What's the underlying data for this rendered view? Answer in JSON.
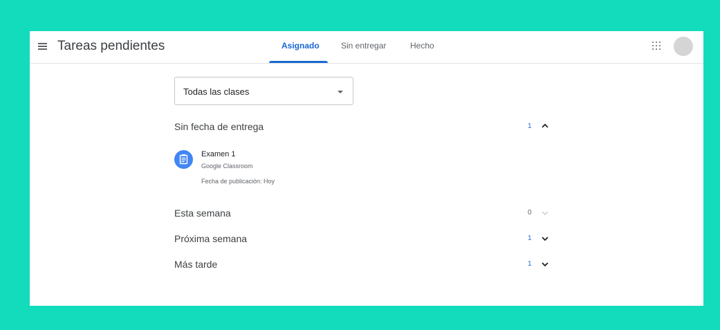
{
  "header": {
    "title": "Tareas pendientes",
    "tabs": [
      {
        "label": "Asignado",
        "active": true
      },
      {
        "label": "Sin entregar",
        "active": false
      },
      {
        "label": "Hecho",
        "active": false
      }
    ],
    "icons": [
      "menu-icon",
      "apps-grid-icon",
      "avatar"
    ]
  },
  "filter": {
    "selected": "Todas las clases"
  },
  "sections": [
    {
      "title": "Sin fecha de entrega",
      "count": "1",
      "expanded": true,
      "items": [
        {
          "title": "Examen 1",
          "class_name": "Google Classroom",
          "posted": "Fecha de publicación: Hoy",
          "icon": "assignment-icon"
        }
      ]
    },
    {
      "title": "Esta semana",
      "count": "0",
      "expanded": false
    },
    {
      "title": "Próxima semana",
      "count": "1",
      "expanded": false
    },
    {
      "title": "Más tarde",
      "count": "1",
      "expanded": false
    }
  ],
  "colors": {
    "background": "#13dcbc",
    "accent": "#1967d2",
    "task_icon": "#4285f4"
  }
}
